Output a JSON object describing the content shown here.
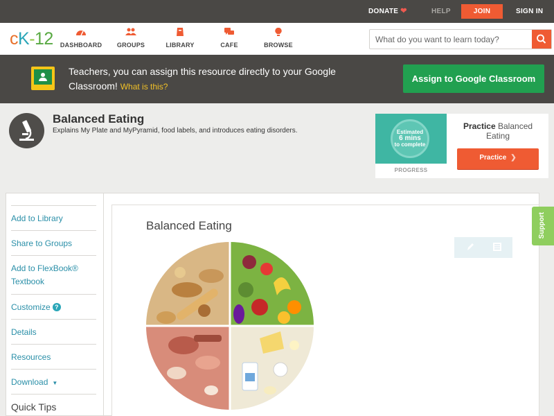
{
  "topbar": {
    "donate": "DONATE",
    "help": "HELP",
    "join": "JOIN",
    "signin": "SIGN IN"
  },
  "nav": {
    "logo": {
      "c": "c",
      "k": "K",
      "dash": "-",
      "num": "12"
    },
    "items": [
      {
        "label": "DASHBOARD",
        "icon": "dashboard-icon"
      },
      {
        "label": "GROUPS",
        "icon": "groups-icon"
      },
      {
        "label": "LIBRARY",
        "icon": "library-icon"
      },
      {
        "label": "CAFE",
        "icon": "cafe-icon"
      },
      {
        "label": "BROWSE",
        "icon": "browse-icon"
      }
    ],
    "search_placeholder": "What do you want to learn today?"
  },
  "banner": {
    "text": "Teachers, you can assign this resource directly to your Google Classroom!",
    "what_link": "What is this?",
    "assign_button": "Assign to Google Classroom"
  },
  "resource": {
    "title": "Balanced Eating",
    "description": "Explains My Plate and MyPyramid, food labels, and introduces eating disorders."
  },
  "practice": {
    "circle_line1": "Estimated",
    "circle_mins": "6 mins",
    "circle_line3": "to complete",
    "progress_label": "PROGRESS",
    "title_bold": "Practice",
    "title_rest": "Balanced Eating",
    "button": "Practice"
  },
  "sidebar": {
    "items": [
      {
        "label": "Add to Library"
      },
      {
        "label": "Share to Groups"
      },
      {
        "label": "Add to FlexBook® Textbook"
      },
      {
        "label": "Customize"
      },
      {
        "label": "Details"
      },
      {
        "label": "Resources"
      },
      {
        "label": "Download"
      },
      {
        "label": "Quick Tips"
      }
    ]
  },
  "main": {
    "title": "Balanced Eating"
  },
  "support": "Support",
  "colors": {
    "accent": "#ef5b33",
    "dark": "#4a4845",
    "green": "#21a050",
    "teal": "#2a8fa8",
    "support": "#8fce5e"
  }
}
